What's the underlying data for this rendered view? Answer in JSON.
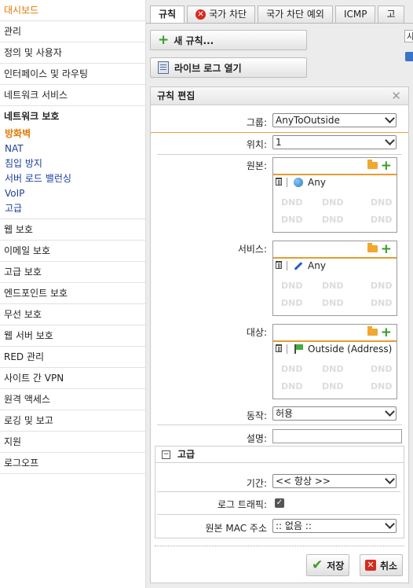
{
  "sidebar": {
    "items": [
      {
        "label": "대시보드",
        "active": true
      },
      {
        "label": "관리"
      },
      {
        "label": "정의 및 사용자"
      },
      {
        "label": "인터페이스 및 라우팅"
      },
      {
        "label": "네트워크 서비스"
      },
      {
        "label": "네트워크 보호"
      }
    ],
    "sub_items": [
      "방화벽",
      "NAT",
      "침입 방지",
      "서버 로드 밸런싱",
      "VoIP",
      "고급"
    ],
    "items_after": [
      "웹 보호",
      "이메일 보호",
      "고급 보호",
      "엔드포인트 보호",
      "무선 보호",
      "웹 서버 보호",
      "RED 관리",
      "사이트 간 VPN",
      "원격 액세스",
      "로깅 및 보고",
      "지원",
      "로그오프"
    ]
  },
  "tabs": [
    "규칙",
    "국가 차단",
    "국가 차단 예외",
    "ICMP",
    "고"
  ],
  "side_input_value": "사",
  "actions": {
    "new_rule": "새 규칙...",
    "live_log": "라이브 로그 열기"
  },
  "dialog": {
    "title": "규칙 편집",
    "group_label": "그룹:",
    "group_value": "AnyToOutside",
    "position_label": "위치:",
    "position_value": "1",
    "source_label": "원본:",
    "source_entry": "Any",
    "service_label": "서비스:",
    "service_entry": "Any",
    "dest_label": "대상:",
    "dest_entry": "Outside (Address)",
    "dnd_text": "DND",
    "action_label": "동작:",
    "action_value": "허용",
    "comment_label": "설명:",
    "advanced_title": "고급",
    "period_label": "기간:",
    "period_value": "<< 항상 >>",
    "log_traffic_label": "로그 트래픽:",
    "source_mac_label": "원본 MAC 주소",
    "source_mac_value": ":: 없음 ::",
    "save_label": "저장",
    "cancel_label": "취소"
  },
  "colors": {
    "accent": "#e07800",
    "link": "#1a3e9a",
    "green": "#3a9b28",
    "red": "#d52b1e"
  }
}
